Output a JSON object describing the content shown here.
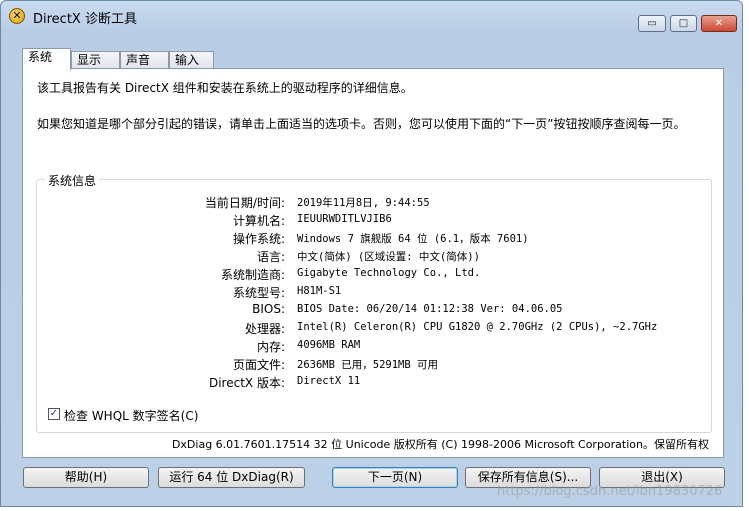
{
  "window": {
    "title": "DirectX 诊断工具",
    "icon": "directx-x-icon",
    "controls": {
      "minimize": "▭",
      "maximize": "□",
      "close": "✕"
    }
  },
  "tabs": [
    "系统",
    "显示",
    "声音",
    "输入"
  ],
  "intro": {
    "line1": "该工具报告有关 DirectX 组件和安装在系统上的驱动程序的详细信息。",
    "line2": "如果您知道是哪个部分引起的错误，请单击上面适当的选项卡。否则，您可以使用下面的“下一页”按钮按顺序查阅每一页。"
  },
  "system_info": {
    "title": "系统信息",
    "rows": [
      {
        "label": "当前日期/时间:",
        "value": "2019年11月8日, 9:44:55"
      },
      {
        "label": "计算机名:",
        "value": "IEUURWDITLVJIB6"
      },
      {
        "label": "操作系统:",
        "value": "Windows 7 旗舰版 64 位 (6.1，版本 7601)"
      },
      {
        "label": "语言:",
        "value": "中文(简体) (区域设置: 中文(简体))"
      },
      {
        "label": "系统制造商:",
        "value": "Gigabyte Technology Co., Ltd."
      },
      {
        "label": "系统型号:",
        "value": "H81M-S1"
      },
      {
        "label": "BIOS:",
        "value": "BIOS Date: 06/20/14 01:12:38 Ver: 04.06.05"
      },
      {
        "label": "处理器:",
        "value": "Intel(R) Celeron(R) CPU G1820 @ 2.70GHz (2 CPUs), ~2.7GHz"
      },
      {
        "label": "内存:",
        "value": "4096MB RAM"
      },
      {
        "label": "页面文件:",
        "value": "2636MB 已用，5291MB 可用"
      },
      {
        "label": "DirectX 版本:",
        "value": "DirectX 11"
      }
    ]
  },
  "whql_check": {
    "label": "检查 WHQL 数字签名(C)",
    "checked": true,
    "mark": "✓"
  },
  "copyright": "DxDiag 6.01.7601.17514 32 位 Unicode 版权所有 (C) 1998-2006 Microsoft Corporation。保留所有权",
  "buttons": {
    "help": "帮助(H)",
    "run64": "运行 64 位 DxDiag(R)",
    "next": "下一页(N)",
    "save": "保存所有信息(S)...",
    "exit": "退出(X)"
  },
  "watermark": "https://blog.csdn.net/lbn19830726"
}
